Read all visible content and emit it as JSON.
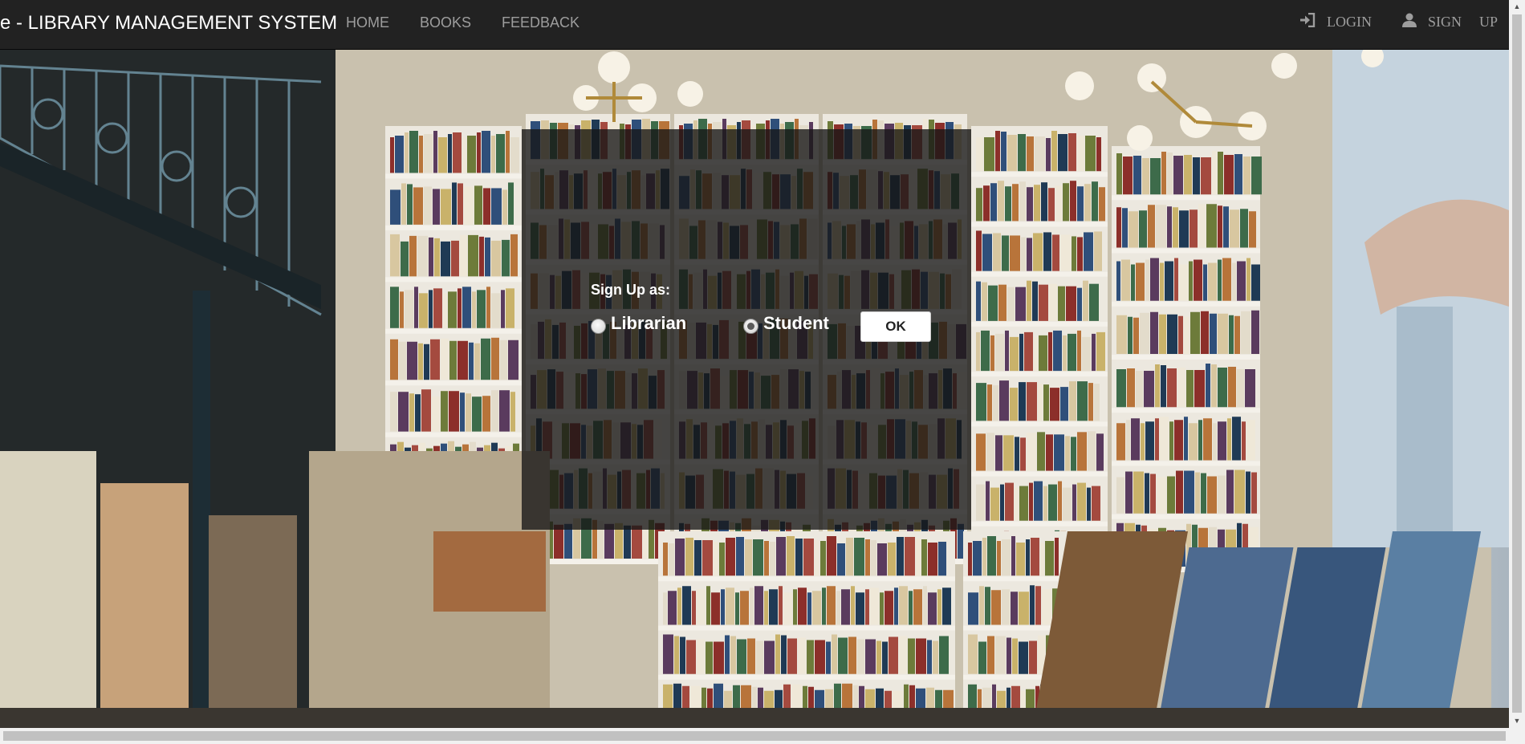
{
  "navbar": {
    "brand": "e - LIBRARY MANAGEMENT SYSTEM",
    "links": [
      "HOME",
      "BOOKS",
      "FEEDBACK"
    ],
    "login": "LOGIN",
    "signup_word1": "SIGN",
    "signup_word2": "UP",
    "background_color": "#222222",
    "link_color": "#9d9d9d"
  },
  "icons": {
    "login": "log-in-icon",
    "signup": "user-icon",
    "background": "library-bookshelves-photo"
  },
  "modal": {
    "label": "Sign Up as:",
    "options": [
      {
        "label": "Librarian",
        "checked": false
      },
      {
        "label": "Student",
        "checked": true
      }
    ],
    "ok_label": "OK"
  }
}
